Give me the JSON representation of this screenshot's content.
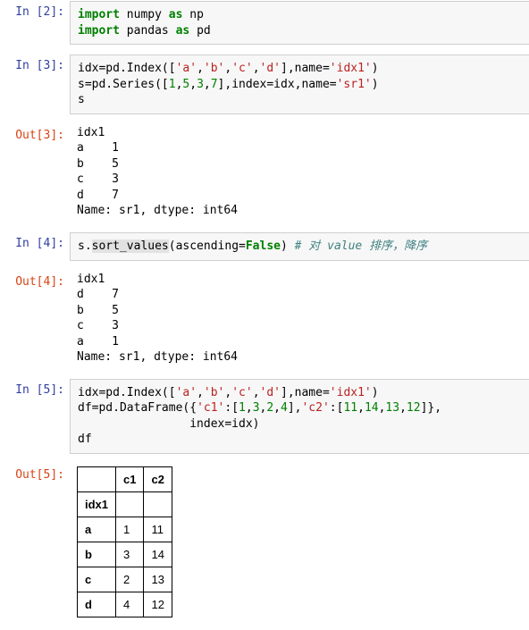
{
  "cells": {
    "in2_prompt": "In [2]:",
    "in3_prompt": "In [3]:",
    "out3_prompt": "Out[3]:",
    "in4_prompt": "In [4]:",
    "out4_prompt": "Out[4]:",
    "in5_prompt": "In [5]:",
    "out5_prompt": "Out[5]:",
    "in2": {
      "l1_kw": "import",
      "l1_mod": " numpy ",
      "l1_as": "as",
      "l1_alias": " np",
      "l2_kw": "import",
      "l2_mod": " pandas ",
      "l2_as": "as",
      "l2_alias": " pd"
    },
    "in3": {
      "l1_a": "idx=pd.Index([",
      "l1_s1": "'a'",
      "l1_c1": ",",
      "l1_s2": "'b'",
      "l1_c2": ",",
      "l1_s3": "'c'",
      "l1_c3": ",",
      "l1_s4": "'d'",
      "l1_b": "],name=",
      "l1_s5": "'idx1'",
      "l1_c": ")",
      "l2_a": "s=pd.Series([",
      "l2_n1": "1",
      "l2_c1": ",",
      "l2_n2": "5",
      "l2_c2": ",",
      "l2_n3": "3",
      "l2_c3": ",",
      "l2_n4": "7",
      "l2_b": "],index=idx,name=",
      "l2_s1": "'sr1'",
      "l2_c": ")",
      "l3": "s"
    },
    "out3": "idx1\na    1\nb    5\nc    3\nd    7\nName: sr1, dtype: int64",
    "in4": {
      "l1_a": "s.",
      "l1_fn": "sort_values",
      "l1_b": "(ascending=",
      "l1_const": "False",
      "l1_c": ") ",
      "l1_cmt": "# 对 value 排序，降序"
    },
    "out4": "idx1\nd    7\nb    5\nc    3\na    1\nName: sr1, dtype: int64",
    "in5": {
      "l1_a": "idx=pd.Index([",
      "l1_s1": "'a'",
      "l1_c1": ",",
      "l1_s2": "'b'",
      "l1_c2": ",",
      "l1_s3": "'c'",
      "l1_c3": ",",
      "l1_s4": "'d'",
      "l1_b": "],name=",
      "l1_s5": "'idx1'",
      "l1_c": ")",
      "l2_a": "df=pd.DataFrame({",
      "l2_s1": "'c1'",
      "l2_b": ":[",
      "l2_n1": "1",
      "l2_c1": ",",
      "l2_n2": "3",
      "l2_c2": ",",
      "l2_n3": "2",
      "l2_c3": ",",
      "l2_n4": "4",
      "l2_c": "],",
      "l2_s2": "'c2'",
      "l2_d": ":[",
      "l2_n5": "11",
      "l2_c4": ",",
      "l2_n6": "14",
      "l2_c5": ",",
      "l2_n7": "13",
      "l2_c6": ",",
      "l2_n8": "12",
      "l2_e": "]},",
      "l3": "                index=idx)",
      "l4": "df"
    },
    "out5_table": {
      "index_name": "idx1",
      "cols": [
        "c1",
        "c2"
      ],
      "rows": [
        {
          "idx": "a",
          "c1": "1",
          "c2": "11"
        },
        {
          "idx": "b",
          "c1": "3",
          "c2": "14"
        },
        {
          "idx": "c",
          "c1": "2",
          "c2": "13"
        },
        {
          "idx": "d",
          "c1": "4",
          "c2": "12"
        }
      ]
    }
  }
}
